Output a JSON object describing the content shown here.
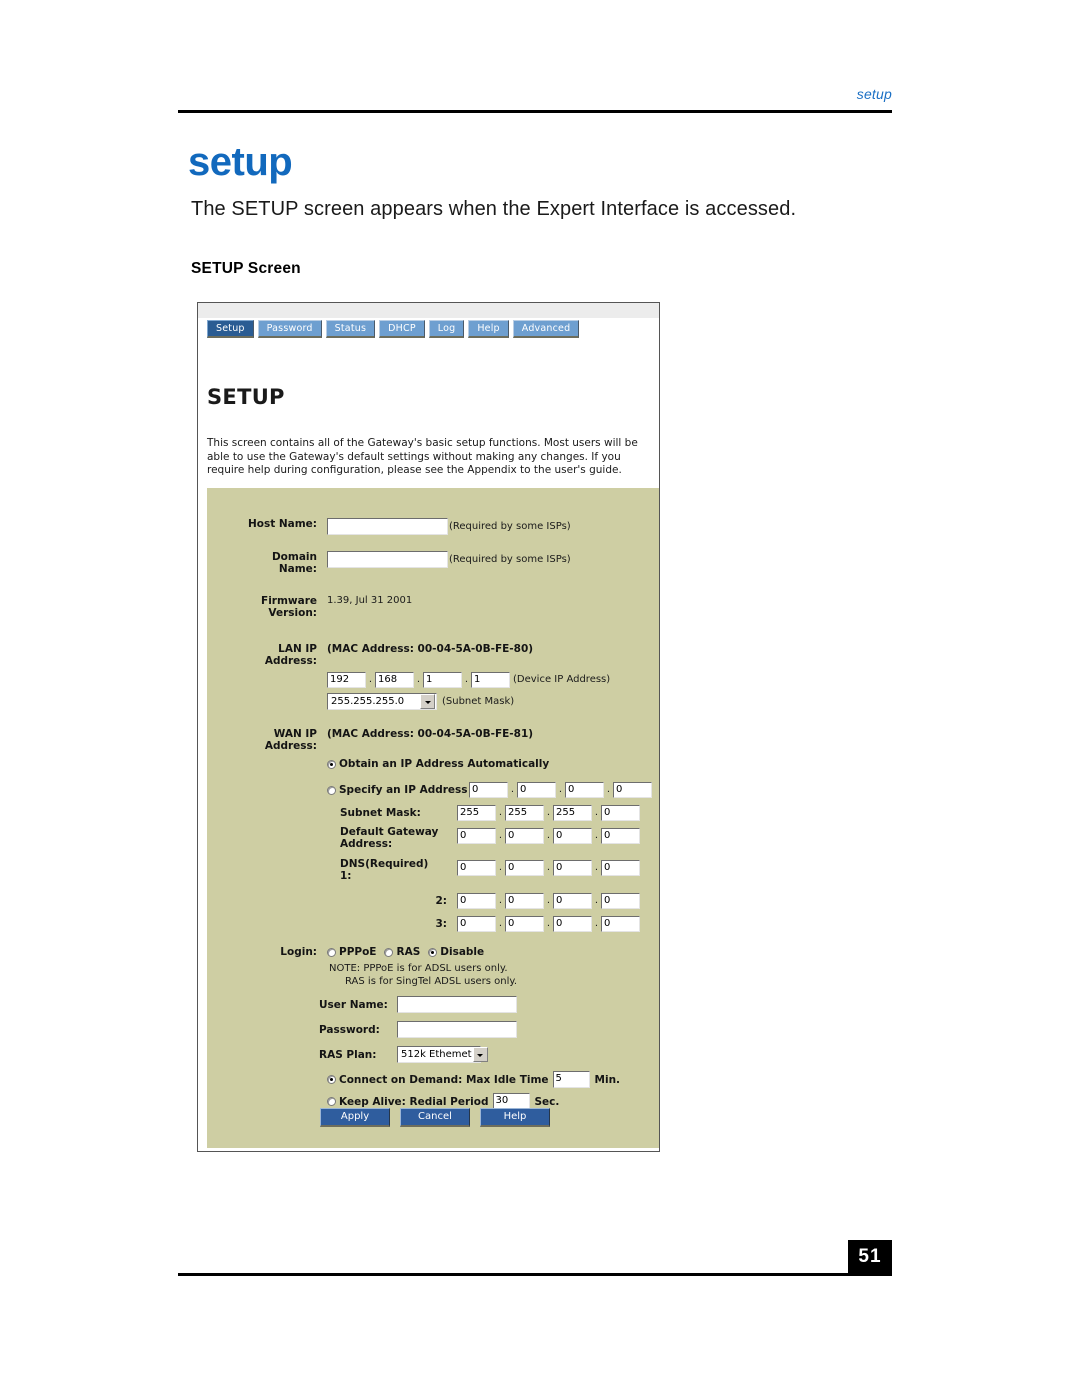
{
  "page": {
    "running_head": "setup",
    "number": "51",
    "chapter_title": "setup",
    "intro": "The SETUP screen appears when the Expert Interface is accessed.",
    "section_label": "SETUP Screen",
    "accent_color": "#1269bd",
    "panel_color": "#ceceA3"
  },
  "screenshot": {
    "tabs": [
      {
        "label": "Setup",
        "active": true
      },
      {
        "label": "Password",
        "active": false
      },
      {
        "label": "Status",
        "active": false
      },
      {
        "label": "DHCP",
        "active": false
      },
      {
        "label": "Log",
        "active": false
      },
      {
        "label": "Help",
        "active": false
      },
      {
        "label": "Advanced",
        "active": false
      }
    ],
    "title": "SETUP",
    "description": "This screen contains all of the Gateway's basic setup functions. Most users will be able to use the Gateway's default settings without making any changes. If you require help during configuration, please see the Appendix to the user's guide.",
    "host_name": {
      "label": "Host Name:",
      "value": "",
      "hint": "(Required by some ISPs)"
    },
    "domain_name": {
      "label": "Domain\nName:",
      "value": "",
      "hint": "(Required by some ISPs)"
    },
    "firmware": {
      "label": "Firmware\nVersion:",
      "value": "1.39, Jul 31 2001"
    },
    "lan_ip": {
      "label": "LAN IP\nAddress:",
      "mac": "(MAC Address: 00-04-5A-0B-FE-80)",
      "octets": [
        "192",
        "168",
        "1",
        "1"
      ],
      "device_hint": "(Device IP Address)",
      "subnet_select": "255.255.255.0",
      "subnet_hint": "(Subnet Mask)"
    },
    "wan_ip": {
      "label": "WAN IP\nAddress:",
      "mac": "(MAC Address: 00-04-5A-0B-FE-81)",
      "obtain_auto": {
        "label": "Obtain an IP Address Automatically",
        "selected": true
      },
      "specify": {
        "label": "Specify an IP Address",
        "selected": false,
        "octets": [
          "0",
          "0",
          "0",
          "0"
        ]
      },
      "subnet_mask": {
        "label": "Subnet Mask:",
        "octets": [
          "255",
          "255",
          "255",
          "0"
        ]
      },
      "gateway": {
        "label": "Default Gateway\nAddress:",
        "octets": [
          "0",
          "0",
          "0",
          "0"
        ]
      },
      "dns1": {
        "label": "DNS(Required)\n 1:",
        "octets": [
          "0",
          "0",
          "0",
          "0"
        ]
      },
      "dns2": {
        "label": "2:",
        "octets": [
          "0",
          "0",
          "0",
          "0"
        ]
      },
      "dns3": {
        "label": "3:",
        "octets": [
          "0",
          "0",
          "0",
          "0"
        ]
      }
    },
    "login": {
      "label": "Login:",
      "options": [
        {
          "label": "PPPoE",
          "selected": false
        },
        {
          "label": "RAS",
          "selected": false
        },
        {
          "label": "Disable",
          "selected": true
        }
      ],
      "note_line1": "NOTE: PPPoE is for ADSL users only.",
      "note_line2": "RAS is for SingTel ADSL users only.",
      "user_name": {
        "label": "User Name:",
        "value": ""
      },
      "password": {
        "label": "Password:",
        "value": ""
      },
      "ras_plan": {
        "label": "RAS Plan:",
        "value": "512k Ethemet"
      },
      "connect_on_demand": {
        "label": "Connect on Demand: Max Idle Time",
        "selected": true,
        "value": "5",
        "unit": "Min."
      },
      "keep_alive": {
        "label": "Keep Alive: Redial Period",
        "selected": false,
        "value": "30",
        "unit": "Sec."
      }
    },
    "buttons": [
      {
        "label": "Apply"
      },
      {
        "label": "Cancel"
      },
      {
        "label": "Help"
      }
    ]
  }
}
